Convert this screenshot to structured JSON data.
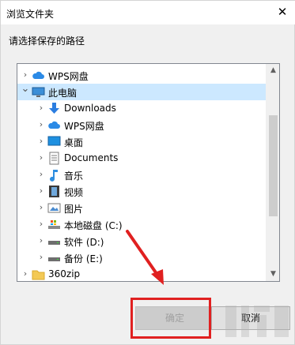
{
  "window": {
    "title": "浏览文件夹",
    "close_glyph": "✕"
  },
  "prompt": "请选择保存的路径",
  "tree": {
    "items": [
      {
        "label": "WPS网盘",
        "icon": "cloud-icon",
        "level": 0,
        "expanded": false
      },
      {
        "label": "此电脑",
        "icon": "computer-icon",
        "level": 0,
        "expanded": true,
        "selected": true
      },
      {
        "label": "Downloads",
        "icon": "download-arrow-icon",
        "level": 1,
        "expanded": false
      },
      {
        "label": "WPS网盘",
        "icon": "cloud-icon",
        "level": 1,
        "expanded": false
      },
      {
        "label": "桌面",
        "icon": "desktop-icon",
        "level": 1,
        "expanded": false
      },
      {
        "label": "Documents",
        "icon": "document-icon",
        "level": 1,
        "expanded": false
      },
      {
        "label": "音乐",
        "icon": "music-note-icon",
        "level": 1,
        "expanded": false
      },
      {
        "label": "视频",
        "icon": "film-icon",
        "level": 1,
        "expanded": false
      },
      {
        "label": "图片",
        "icon": "picture-icon",
        "level": 1,
        "expanded": false
      },
      {
        "label": "本地磁盘 (C:)",
        "icon": "system-drive-icon",
        "level": 1,
        "expanded": false
      },
      {
        "label": "软件 (D:)",
        "icon": "drive-icon",
        "level": 1,
        "expanded": false
      },
      {
        "label": "备份 (E:)",
        "icon": "drive-icon",
        "level": 1,
        "expanded": false
      },
      {
        "label": "360zip",
        "icon": "folder-icon",
        "level": 0,
        "expanded": false
      }
    ]
  },
  "buttons": {
    "ok": "确定",
    "cancel": "取消"
  },
  "colors": {
    "selection": "#cce8ff",
    "annotation": "#e02020",
    "cloud": "#2b8ae6"
  }
}
